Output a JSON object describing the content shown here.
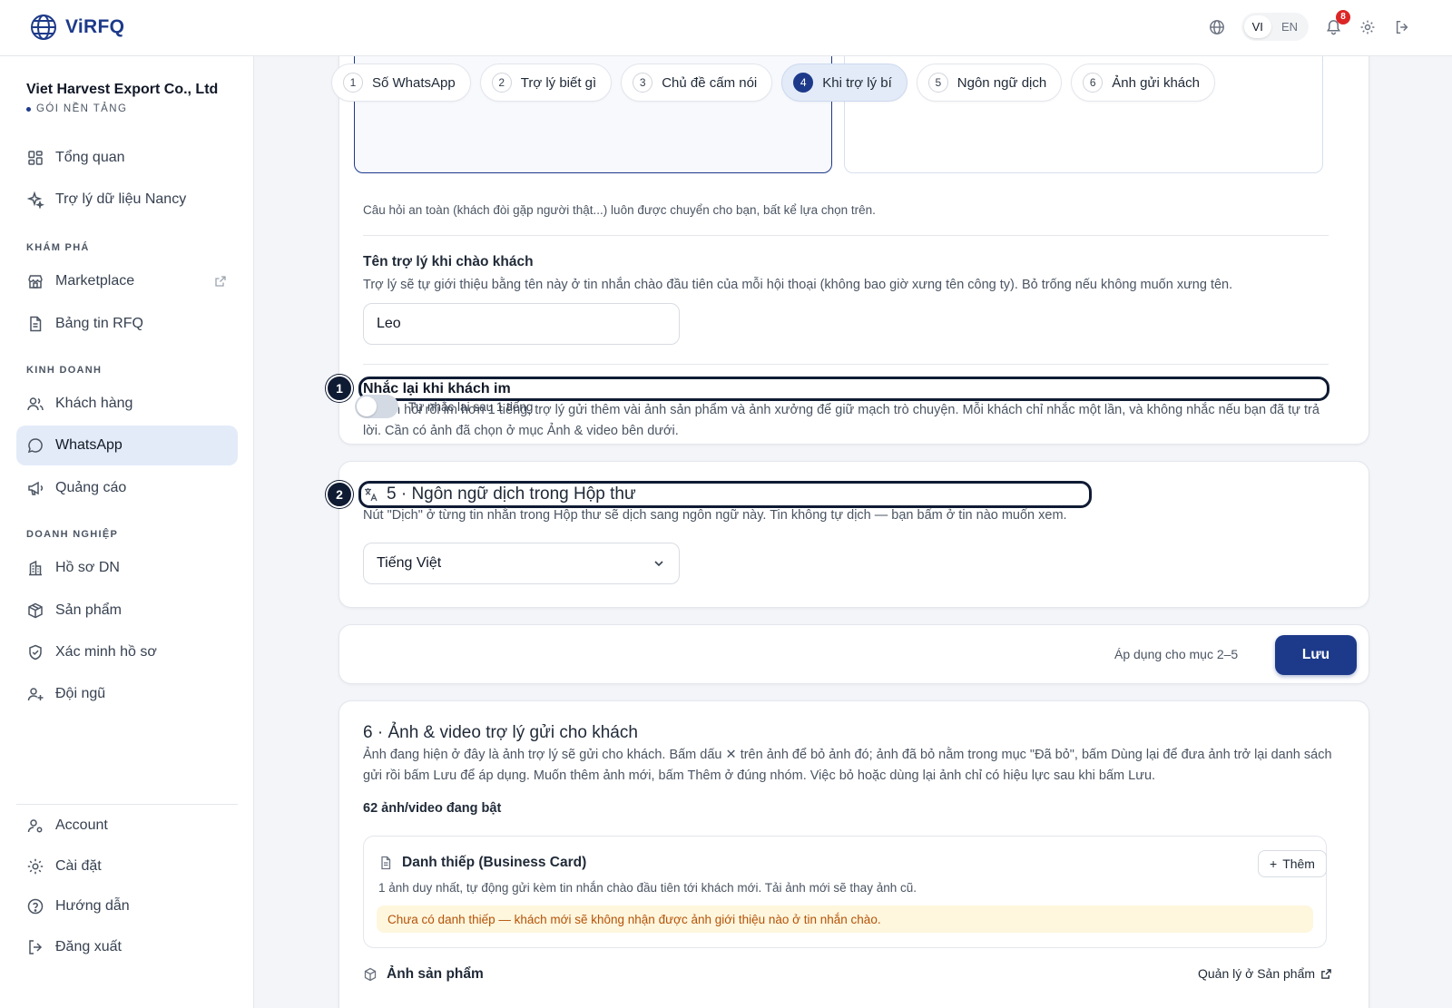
{
  "header": {
    "logo_text": "ViRFQ",
    "lang_vi": "VI",
    "lang_en": "EN",
    "notification_count": "8"
  },
  "sidebar": {
    "company_name": "Viet Harvest Export Co., Ltd",
    "company_plan": "GÓI NỀN TẢNG",
    "items": [
      {
        "label": "Tổng quan",
        "icon": "dashboard-icon"
      },
      {
        "label": "Trợ lý dữ liệu Nancy",
        "icon": "sparkle-icon"
      },
      {
        "label": "Marketplace",
        "icon": "store-icon"
      },
      {
        "label": "Bảng tin RFQ",
        "icon": "document-icon"
      },
      {
        "label": "Khách hàng",
        "icon": "users-icon"
      },
      {
        "label": "WhatsApp",
        "icon": "chat-icon"
      },
      {
        "label": "Quảng cáo",
        "icon": "megaphone-icon"
      },
      {
        "label": "Hồ sơ DN",
        "icon": "building-icon"
      },
      {
        "label": "Sản phẩm",
        "icon": "box-icon"
      },
      {
        "label": "Xác minh hồ sơ",
        "icon": "shield-check-icon"
      },
      {
        "label": "Đội ngũ",
        "icon": "user-plus-icon"
      }
    ],
    "sections": {
      "explore": "KHÁM PHÁ",
      "business": "KINH DOANH",
      "enterprise": "DOANH NGHIỆP"
    },
    "bottom_items": [
      {
        "label": "Account",
        "icon": "account-icon"
      },
      {
        "label": "Cài đặt",
        "icon": "gear-icon"
      },
      {
        "label": "Hướng dẫn",
        "icon": "help-icon"
      },
      {
        "label": "Đăng xuất",
        "icon": "logout-icon"
      }
    ]
  },
  "tabs": [
    {
      "num": "1",
      "label": "Số WhatsApp"
    },
    {
      "num": "2",
      "label": "Trợ lý biết gì"
    },
    {
      "num": "3",
      "label": "Chủ đề cấm nói"
    },
    {
      "num": "4",
      "label": "Khi trợ lý bí"
    },
    {
      "num": "5",
      "label": "Ngôn ngữ dịch"
    },
    {
      "num": "6",
      "label": "Ảnh gửi khách"
    }
  ],
  "behavior": {
    "safety_note": "Câu hỏi an toàn (khách đòi gặp người thật...) luôn được chuyển cho bạn, bất kể lựa chọn trên.",
    "assistant_name_title": "Tên trợ lý khi chào khách",
    "assistant_name_desc": "Trợ lý sẽ tự giới thiệu bằng tên này ở tin nhắn chào đầu tiên của mỗi hội thoại (không bao giờ xưng tên công ty). Bỏ trống nếu không muốn xưng tên.",
    "assistant_name_value": "Leo",
    "reminder_title": "Nhắc lại khi khách im",
    "reminder_desc": "Khách hỏi rồi im hơn 1 tiếng, trợ lý gửi thêm vài ảnh sản phẩm và ảnh xưởng để giữ mạch trò chuyện. Mỗi khách chỉ nhắc một lần, và không nhắc nếu bạn đã tự trả lời. Cần có ảnh đã chọn ở mục Ảnh & video bên dưới.",
    "reminder_toggle_label": "Tự nhắc lại sau 1 tiếng"
  },
  "annotations": {
    "one": "1",
    "two": "2"
  },
  "translation": {
    "title": "5 · Ngôn ngữ dịch trong Hộp thư",
    "desc": "Nút \"Dịch\" ở từng tin nhắn trong Hộp thư sẽ dịch sang ngôn ngữ này. Tin không tự dịch — bạn bấm ở tin nào muốn xem.",
    "selected_language": "Tiếng Việt"
  },
  "save_bar": {
    "note": "Áp dụng cho mục 2–5",
    "button": "Lưu"
  },
  "media": {
    "title": "6 · Ảnh & video trợ lý gửi cho khách",
    "desc": "Ảnh đang hiện ở đây là ảnh trợ lý sẽ gửi cho khách. Bấm dấu ✕ trên ảnh để bỏ ảnh đó; ảnh đã bỏ nằm trong mục \"Đã bỏ\", bấm Dùng lại để đưa ảnh trở lại danh sách gửi rồi bấm Lưu để áp dụng. Muốn thêm ảnh mới, bấm Thêm ở đúng nhóm. Việc bỏ hoặc dùng lại ảnh chỉ có hiệu lực sau khi bấm Lưu.",
    "count": "62 ảnh/video đang bật",
    "business_card": {
      "title": "Danh thiếp (Business Card)",
      "add": "Thêm",
      "desc": "1 ảnh duy nhất, tự động gửi kèm tin nhắn chào đầu tiên tới khách mới. Tải ảnh mới sẽ thay ảnh cũ.",
      "warning": "Chưa có danh thiếp — khách mới sẽ không nhận được ảnh giới thiệu nào ở tin nhắn chào."
    },
    "products_title": "Ảnh sản phẩm",
    "products_link": "Quản lý ở Sản phẩm"
  },
  "colors": {
    "brand": "#1d3a8a",
    "active_nav": "#e3ebf8",
    "warning_bg": "#fef6dd",
    "warning_text": "#b45309",
    "badge": "#dc2626"
  }
}
